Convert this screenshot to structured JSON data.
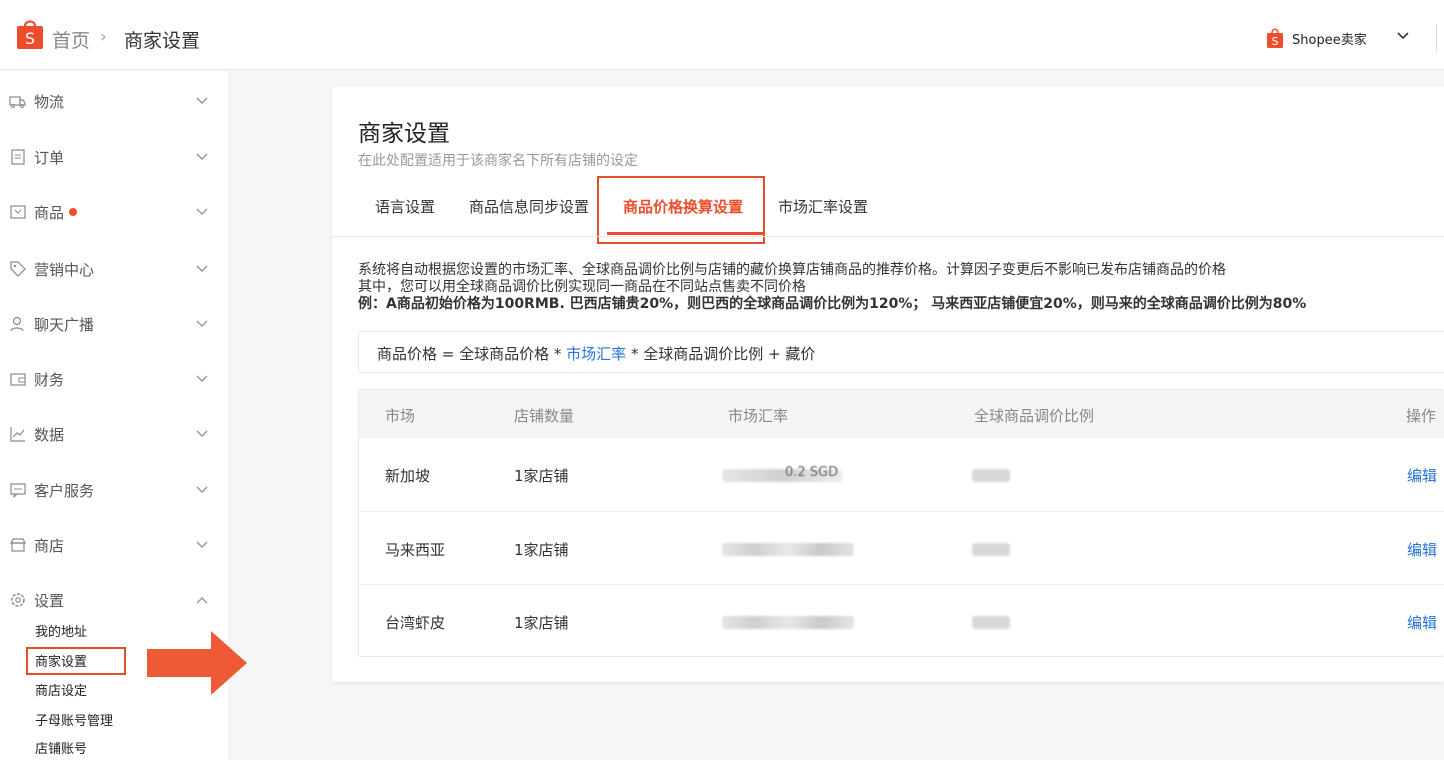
{
  "header": {
    "breadcrumb_home": "首页",
    "breadcrumb_sep": "›",
    "breadcrumb_current": "商家设置",
    "seller_name": "Shopee卖家",
    "brand_color": "#ee4d2d"
  },
  "sidebar": {
    "items": [
      {
        "label": "物流",
        "icon": "truck-icon"
      },
      {
        "label": "订单",
        "icon": "clipboard-icon"
      },
      {
        "label": "商品",
        "icon": "box-icon"
      },
      {
        "label": "营销中心",
        "icon": "tag-icon"
      },
      {
        "label": "聊天广播",
        "icon": "chat-user-icon"
      },
      {
        "label": "财务",
        "icon": "wallet-icon"
      },
      {
        "label": "数据",
        "icon": "chart-icon"
      },
      {
        "label": "客户服务",
        "icon": "chat-icon"
      },
      {
        "label": "商店",
        "icon": "store-icon"
      },
      {
        "label": "设置",
        "icon": "gear-icon"
      }
    ],
    "settings_sub": [
      "我的地址",
      "商家设置",
      "商店设定",
      "子母账号管理",
      "店铺账号"
    ]
  },
  "main": {
    "title": "商家设置",
    "subtitle": "在此处配置适用于该商家名下所有店铺的设定",
    "tabs": [
      "语言设置",
      "商品信息同步设置",
      "商品价格换算设置",
      "市场汇率设置"
    ],
    "active_tab": 2,
    "desc_line1": "系统将自动根据您设置的市场汇率、全球商品调价比例与店铺的藏价换算店铺商品的推荐价格。计算因子变更后不影响已发布店铺商品的价格",
    "desc_line2": "其中，您可以用全球商品调价比例实现同一商品在不同站点售卖不同价格",
    "desc_line3": "例：A商品初始价格为100RMB. 巴西店铺贵20%，则巴西的全球商品调价比例为120%； 马来西亚店铺便宜20%，则马来的全球商品调价比例为80%",
    "formula_a": "商品价格 = 全球商品价格 * ",
    "formula_link": "市场汇率",
    "formula_b": " * 全球商品调价比例 + 藏价",
    "table": {
      "headers": [
        "市场",
        "店铺数量",
        "市场汇率",
        "全球商品调价比例",
        "操作"
      ],
      "rows": [
        {
          "market": "新加坡",
          "shops": "1家店铺",
          "rate_visible": "0.2 SGD",
          "action": "编辑"
        },
        {
          "market": "马来西亚",
          "shops": "1家店铺",
          "rate_visible": "",
          "action": "编辑"
        },
        {
          "market": "台湾虾皮",
          "shops": "1家店铺",
          "rate_visible": "",
          "action": "编辑"
        }
      ]
    }
  }
}
